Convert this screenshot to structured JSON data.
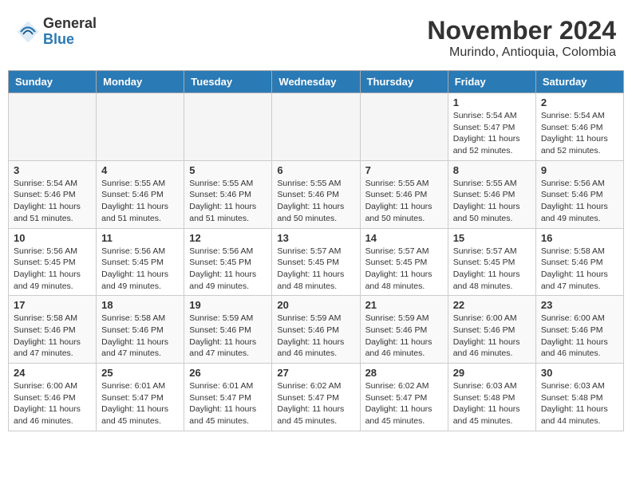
{
  "header": {
    "logo_line1": "General",
    "logo_line2": "Blue",
    "month_year": "November 2024",
    "location": "Murindo, Antioquia, Colombia"
  },
  "weekdays": [
    "Sunday",
    "Monday",
    "Tuesday",
    "Wednesday",
    "Thursday",
    "Friday",
    "Saturday"
  ],
  "weeks": [
    [
      {
        "day": "",
        "sunrise": "",
        "sunset": "",
        "daylight": ""
      },
      {
        "day": "",
        "sunrise": "",
        "sunset": "",
        "daylight": ""
      },
      {
        "day": "",
        "sunrise": "",
        "sunset": "",
        "daylight": ""
      },
      {
        "day": "",
        "sunrise": "",
        "sunset": "",
        "daylight": ""
      },
      {
        "day": "",
        "sunrise": "",
        "sunset": "",
        "daylight": ""
      },
      {
        "day": "1",
        "sunrise": "Sunrise: 5:54 AM",
        "sunset": "Sunset: 5:47 PM",
        "daylight": "Daylight: 11 hours and 52 minutes."
      },
      {
        "day": "2",
        "sunrise": "Sunrise: 5:54 AM",
        "sunset": "Sunset: 5:46 PM",
        "daylight": "Daylight: 11 hours and 52 minutes."
      }
    ],
    [
      {
        "day": "3",
        "sunrise": "Sunrise: 5:54 AM",
        "sunset": "Sunset: 5:46 PM",
        "daylight": "Daylight: 11 hours and 51 minutes."
      },
      {
        "day": "4",
        "sunrise": "Sunrise: 5:55 AM",
        "sunset": "Sunset: 5:46 PM",
        "daylight": "Daylight: 11 hours and 51 minutes."
      },
      {
        "day": "5",
        "sunrise": "Sunrise: 5:55 AM",
        "sunset": "Sunset: 5:46 PM",
        "daylight": "Daylight: 11 hours and 51 minutes."
      },
      {
        "day": "6",
        "sunrise": "Sunrise: 5:55 AM",
        "sunset": "Sunset: 5:46 PM",
        "daylight": "Daylight: 11 hours and 50 minutes."
      },
      {
        "day": "7",
        "sunrise": "Sunrise: 5:55 AM",
        "sunset": "Sunset: 5:46 PM",
        "daylight": "Daylight: 11 hours and 50 minutes."
      },
      {
        "day": "8",
        "sunrise": "Sunrise: 5:55 AM",
        "sunset": "Sunset: 5:46 PM",
        "daylight": "Daylight: 11 hours and 50 minutes."
      },
      {
        "day": "9",
        "sunrise": "Sunrise: 5:56 AM",
        "sunset": "Sunset: 5:46 PM",
        "daylight": "Daylight: 11 hours and 49 minutes."
      }
    ],
    [
      {
        "day": "10",
        "sunrise": "Sunrise: 5:56 AM",
        "sunset": "Sunset: 5:45 PM",
        "daylight": "Daylight: 11 hours and 49 minutes."
      },
      {
        "day": "11",
        "sunrise": "Sunrise: 5:56 AM",
        "sunset": "Sunset: 5:45 PM",
        "daylight": "Daylight: 11 hours and 49 minutes."
      },
      {
        "day": "12",
        "sunrise": "Sunrise: 5:56 AM",
        "sunset": "Sunset: 5:45 PM",
        "daylight": "Daylight: 11 hours and 49 minutes."
      },
      {
        "day": "13",
        "sunrise": "Sunrise: 5:57 AM",
        "sunset": "Sunset: 5:45 PM",
        "daylight": "Daylight: 11 hours and 48 minutes."
      },
      {
        "day": "14",
        "sunrise": "Sunrise: 5:57 AM",
        "sunset": "Sunset: 5:45 PM",
        "daylight": "Daylight: 11 hours and 48 minutes."
      },
      {
        "day": "15",
        "sunrise": "Sunrise: 5:57 AM",
        "sunset": "Sunset: 5:45 PM",
        "daylight": "Daylight: 11 hours and 48 minutes."
      },
      {
        "day": "16",
        "sunrise": "Sunrise: 5:58 AM",
        "sunset": "Sunset: 5:46 PM",
        "daylight": "Daylight: 11 hours and 47 minutes."
      }
    ],
    [
      {
        "day": "17",
        "sunrise": "Sunrise: 5:58 AM",
        "sunset": "Sunset: 5:46 PM",
        "daylight": "Daylight: 11 hours and 47 minutes."
      },
      {
        "day": "18",
        "sunrise": "Sunrise: 5:58 AM",
        "sunset": "Sunset: 5:46 PM",
        "daylight": "Daylight: 11 hours and 47 minutes."
      },
      {
        "day": "19",
        "sunrise": "Sunrise: 5:59 AM",
        "sunset": "Sunset: 5:46 PM",
        "daylight": "Daylight: 11 hours and 47 minutes."
      },
      {
        "day": "20",
        "sunrise": "Sunrise: 5:59 AM",
        "sunset": "Sunset: 5:46 PM",
        "daylight": "Daylight: 11 hours and 46 minutes."
      },
      {
        "day": "21",
        "sunrise": "Sunrise: 5:59 AM",
        "sunset": "Sunset: 5:46 PM",
        "daylight": "Daylight: 11 hours and 46 minutes."
      },
      {
        "day": "22",
        "sunrise": "Sunrise: 6:00 AM",
        "sunset": "Sunset: 5:46 PM",
        "daylight": "Daylight: 11 hours and 46 minutes."
      },
      {
        "day": "23",
        "sunrise": "Sunrise: 6:00 AM",
        "sunset": "Sunset: 5:46 PM",
        "daylight": "Daylight: 11 hours and 46 minutes."
      }
    ],
    [
      {
        "day": "24",
        "sunrise": "Sunrise: 6:00 AM",
        "sunset": "Sunset: 5:46 PM",
        "daylight": "Daylight: 11 hours and 46 minutes."
      },
      {
        "day": "25",
        "sunrise": "Sunrise: 6:01 AM",
        "sunset": "Sunset: 5:47 PM",
        "daylight": "Daylight: 11 hours and 45 minutes."
      },
      {
        "day": "26",
        "sunrise": "Sunrise: 6:01 AM",
        "sunset": "Sunset: 5:47 PM",
        "daylight": "Daylight: 11 hours and 45 minutes."
      },
      {
        "day": "27",
        "sunrise": "Sunrise: 6:02 AM",
        "sunset": "Sunset: 5:47 PM",
        "daylight": "Daylight: 11 hours and 45 minutes."
      },
      {
        "day": "28",
        "sunrise": "Sunrise: 6:02 AM",
        "sunset": "Sunset: 5:47 PM",
        "daylight": "Daylight: 11 hours and 45 minutes."
      },
      {
        "day": "29",
        "sunrise": "Sunrise: 6:03 AM",
        "sunset": "Sunset: 5:48 PM",
        "daylight": "Daylight: 11 hours and 45 minutes."
      },
      {
        "day": "30",
        "sunrise": "Sunrise: 6:03 AM",
        "sunset": "Sunset: 5:48 PM",
        "daylight": "Daylight: 11 hours and 44 minutes."
      }
    ]
  ]
}
